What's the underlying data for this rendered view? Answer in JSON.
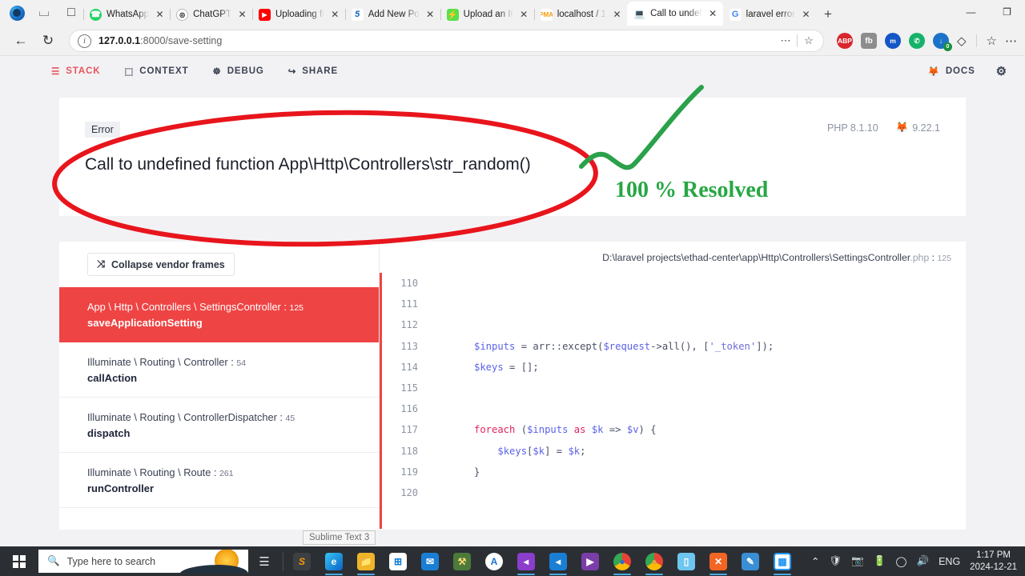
{
  "browser": {
    "window_buttons": {
      "minimize": "—",
      "restore": "❐",
      "close": "✕"
    },
    "tab_actions": {
      "new_tab": "+",
      "tab_search": "▼",
      "split": "❑",
      "workspaces": "❐"
    },
    "tabs": [
      {
        "title": "WhatsApp",
        "favicon": "whatsapp-icon",
        "glyph": "✆",
        "active": false
      },
      {
        "title": "ChatGPT",
        "favicon": "chatgpt-icon",
        "glyph": "◎",
        "active": false
      },
      {
        "title": "Uploading fi",
        "favicon": "youtube-icon",
        "glyph": "▶",
        "active": false
      },
      {
        "title": "Add New Po",
        "favicon": "wordpress-s5-icon",
        "glyph": "5",
        "active": false
      },
      {
        "title": "Upload an It",
        "favicon": "bolt-icon",
        "glyph": "⚡",
        "active": false
      },
      {
        "title": "localhost / 1",
        "favicon": "phpmyadmin-icon",
        "glyph": "PMA",
        "active": false
      },
      {
        "title": "Call to undef",
        "favicon": "laptop-icon",
        "glyph": "Ὃb",
        "active": true
      },
      {
        "title": "laravel error",
        "favicon": "google-icon",
        "glyph": "G",
        "active": false
      }
    ],
    "nav": {
      "back": "←",
      "reload": "↻"
    },
    "address": {
      "host": "127.0.0.1",
      "rest": ":8000/save-setting",
      "full": "127.0.0.1:8000/save-setting",
      "info_icon": "i"
    },
    "address_actions": {
      "more": "⋯",
      "favorite": "☆"
    },
    "extensions": [
      {
        "name": "adblock-plus-icon",
        "label": "ABP",
        "color": "#d9262c"
      },
      {
        "name": "fb-extension-icon",
        "label": "fb",
        "color": "#8d8d8d"
      },
      {
        "name": "messenger-extension-icon",
        "label": "m",
        "color": "#1456c7"
      },
      {
        "name": "whatsapp-extension-icon",
        "label": "✆",
        "color": "#15b36a"
      },
      {
        "name": "downloader-extension-icon",
        "label": "↓",
        "color": "#1a73c8",
        "badge": "0"
      }
    ],
    "toolbar_right": {
      "copilot": "◇",
      "collections": "☆",
      "settings_more": "⋯"
    }
  },
  "ignition": {
    "nav": [
      {
        "label": "STACK",
        "icon": "stack-icon",
        "glyph": "☰",
        "active": true
      },
      {
        "label": "CONTEXT",
        "icon": "context-icon",
        "glyph": "⬚",
        "active": false
      },
      {
        "label": "DEBUG",
        "icon": "debug-icon",
        "glyph": "☸",
        "active": false
      },
      {
        "label": "SHARE",
        "icon": "share-icon",
        "glyph": "↪",
        "active": false
      }
    ],
    "docs": {
      "label": "DOCS",
      "icon": "laravel-icon",
      "glyph": "ὒ5"
    },
    "settings_icon": "gear-icon",
    "error": {
      "badge": "Error",
      "message": "Call to undefined function App\\Http\\Controllers\\str_random()",
      "php_version": "PHP 8.1.10",
      "laravel_version": "9.22.1"
    },
    "collapse_button": {
      "label": "Collapse vendor frames",
      "icon": "collapse-icon",
      "glyph": "⤨"
    },
    "frames": [
      {
        "class": "App \\ Http \\ Controllers \\ SettingsController",
        "line": "125",
        "method": "saveApplicationSetting",
        "selected": true
      },
      {
        "class": "Illuminate \\ Routing \\ Controller",
        "line": "54",
        "method": "callAction",
        "selected": false
      },
      {
        "class": "Illuminate \\ Routing \\ ControllerDispatcher",
        "line": "45",
        "method": "dispatch",
        "selected": false
      },
      {
        "class": "Illuminate \\ Routing \\ Route",
        "line": "261",
        "method": "runController",
        "selected": false
      }
    ],
    "code": {
      "file_path": "D:\\laravel projects\\ethad-center\\app\\Http\\Controllers\\SettingsController",
      "file_ext": ".php",
      "file_line": "125",
      "lines": [
        {
          "num": "110",
          "text": ""
        },
        {
          "num": "111",
          "text": ""
        },
        {
          "num": "112",
          "text": ""
        },
        {
          "num": "113",
          "text": "$inputs = arr::except($request->all(), ['_token']);"
        },
        {
          "num": "114",
          "text": "$keys = [];"
        },
        {
          "num": "115",
          "text": ""
        },
        {
          "num": "116",
          "text": ""
        },
        {
          "num": "117",
          "text": "foreach ($inputs as $k => $v) {"
        },
        {
          "num": "118",
          "text": "    $keys[$k] = $k;"
        },
        {
          "num": "119",
          "text": "}"
        },
        {
          "num": "120",
          "text": ""
        }
      ]
    }
  },
  "annotations": {
    "resolved_text": "100 % Resolved",
    "ellipse_color": "#e8151c",
    "check_color": "#2aa14a",
    "resolved_color": "#27a744"
  },
  "tooltip": {
    "text": "Sublime Text 3"
  },
  "taskbar": {
    "start_icon": "windows-start-icon",
    "search_placeholder": "Type here to search",
    "search_icon": "search-icon",
    "taskview_icon": "task-view-icon",
    "apps": [
      {
        "name": "sublime-text-icon",
        "glyph": "S",
        "color": "#ff9800",
        "open": false
      },
      {
        "name": "edge-icon",
        "glyph": "e",
        "color": "#1f7fd4",
        "open": true
      },
      {
        "name": "file-explorer-icon",
        "glyph": "Ὄ1",
        "color": "#f0b429",
        "open": true
      },
      {
        "name": "microsoft-store-icon",
        "glyph": "⊞",
        "color": "#ffffff",
        "open": false
      },
      {
        "name": "mail-icon",
        "glyph": "✉",
        "color": "#1a7fd4",
        "open": false
      },
      {
        "name": "tools-icon",
        "glyph": "⚒",
        "color": "#d4b26a",
        "open": false
      },
      {
        "name": "android-studio-icon",
        "glyph": "A",
        "color": "#ffffff",
        "open": false
      },
      {
        "name": "vs-code-insiders-icon",
        "glyph": "⌨",
        "color": "#8a3ecb",
        "open": true
      },
      {
        "name": "vs-code-icon",
        "glyph": "⌨",
        "color": "#1a7fd4",
        "open": true
      },
      {
        "name": "video-editor-icon",
        "glyph": "▶",
        "color": "#7b3ea8",
        "open": false
      },
      {
        "name": "chrome-icon",
        "glyph": "◉",
        "color": "#34a853",
        "open": true
      },
      {
        "name": "chrome-canary-icon",
        "glyph": "◉",
        "color": "#e8a33d",
        "open": true
      },
      {
        "name": "notepad-icon",
        "glyph": "◧",
        "color": "#6ec6f0",
        "open": false
      },
      {
        "name": "xampp-icon",
        "glyph": "✕",
        "color": "#f26522",
        "open": true
      },
      {
        "name": "paint-icon",
        "glyph": "✎",
        "color": "#3a8fd4",
        "open": false
      },
      {
        "name": "app-icon",
        "glyph": "▫",
        "color": "#2196f3",
        "open": true
      }
    ],
    "tray": {
      "chevron": "⌃",
      "security_icon": "security-shield-icon",
      "camera_icon": "camera-icon",
      "battery_icon": "battery-icon",
      "wifi_icon": "wifi-icon",
      "volume_icon": "volume-icon",
      "language": "ENG",
      "time": "1:17 PM",
      "date": "2024-12-21"
    }
  }
}
